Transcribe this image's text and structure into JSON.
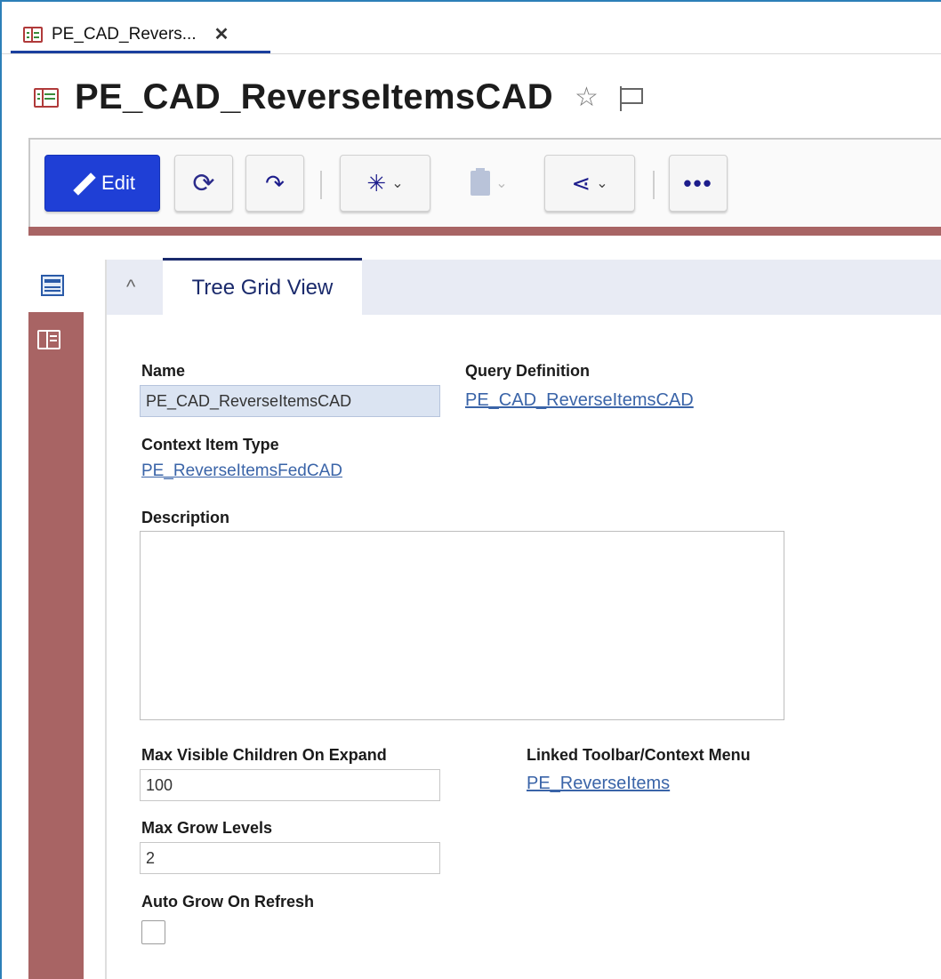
{
  "tab": {
    "label": "PE_CAD_Revers...",
    "close_glyph": "✕",
    "icon": "tree-grid-icon"
  },
  "header": {
    "title": "PE_CAD_ReverseItemsCAD",
    "title_icon": "tree-grid-icon",
    "star_icon": "star-outline-icon",
    "flag_icon": "flag-outline-icon"
  },
  "toolbar": {
    "edit_label": "Edit",
    "buttons": [
      "edit-button",
      "refresh-button",
      "promote-button",
      "structure-menu-button",
      "report-menu-button",
      "share-menu-button",
      "more-button"
    ],
    "accent_color": "#a86464",
    "primary_color": "#1f3fd6"
  },
  "panel": {
    "tab_label": "Tree Grid View",
    "collapse_glyph": "^"
  },
  "form": {
    "name_label": "Name",
    "name_value": "PE_CAD_ReverseItemsCAD",
    "query_label": "Query Definition",
    "query_value": "PE_CAD_ReverseItemsCAD",
    "context_label": "Context Item Type",
    "context_value": "PE_ReverseItemsFedCAD",
    "description_label": "Description",
    "description_value": "",
    "max_children_label": "Max Visible Children On Expand",
    "max_children_value": "100",
    "linked_toolbar_label": "Linked Toolbar/Context Menu",
    "linked_toolbar_value": "PE_ReverseItems",
    "max_grow_label": "Max Grow Levels",
    "max_grow_value": "2",
    "auto_grow_label": "Auto Grow On Refresh",
    "auto_grow_checked": false
  }
}
